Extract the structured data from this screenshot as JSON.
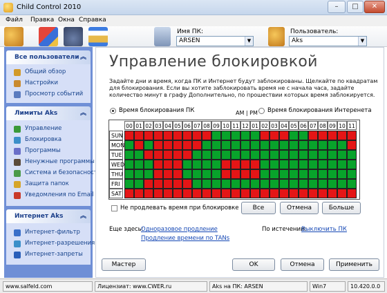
{
  "window": {
    "title": "Child Control 2010",
    "min_glyph": "–",
    "max_glyph": "□",
    "close_glyph": "✕"
  },
  "menu": [
    "Файл",
    "Правка",
    "Окна",
    "Справка"
  ],
  "toolbar": {
    "icons": [
      "users-icon",
      "chart-icon",
      "lock-icon",
      "hourglass-icon"
    ],
    "pc_label": "Имя ПК:",
    "pc_value": "ARSEN",
    "user_label": "Пользователь:",
    "user_value": "Aks",
    "arrow_glyph": "▼"
  },
  "sidebar": {
    "collapse_glyph": "︽",
    "sections": [
      {
        "title": "Все пользователи",
        "items": [
          {
            "label": "Общий обзор",
            "icon": "overview-icon",
            "color": "#d29a2a"
          },
          {
            "label": "Настройки",
            "icon": "settings-icon",
            "color": "#c98a2f"
          },
          {
            "label": "Просмотр событий",
            "icon": "events-icon",
            "color": "#5a7bbf"
          }
        ]
      },
      {
        "title": "Лимиты Aks",
        "items": [
          {
            "label": "Управление",
            "icon": "control-icon",
            "color": "#3a9a3a"
          },
          {
            "label": "Блокировка",
            "icon": "block-icon",
            "color": "#3c8fc9"
          },
          {
            "label": "Программы",
            "icon": "programs-icon",
            "color": "#6a6fc9"
          },
          {
            "label": "Ненужные программы",
            "icon": "unwanted-programs-icon",
            "color": "#5a4a3a"
          },
          {
            "label": "Система и безопасность",
            "icon": "system-icon",
            "color": "#4a9a4a"
          },
          {
            "label": "Защита папок",
            "icon": "folder-protect-icon",
            "color": "#d6a52a"
          },
          {
            "label": "Уведомления по Email",
            "icon": "email-icon",
            "color": "#c93a2a"
          }
        ]
      },
      {
        "title": "Интернет Aks",
        "items": [
          {
            "label": "Интернет-фильтр",
            "icon": "filter-icon",
            "color": "#3a6fc9"
          },
          {
            "label": "Интернет-разрешения",
            "icon": "allow-icon",
            "color": "#3a8fc9"
          },
          {
            "label": "Интернет-запреты",
            "icon": "deny-icon",
            "color": "#2a5fb9"
          }
        ]
      }
    ]
  },
  "main": {
    "heading": "Управление блокировкой",
    "description": "Задайте дни и время, когда ПК и Интернет будут заблокированы. Щелкайте по квадратам для блокирования. Если вы хотите заблокировать время не с начала часа, задайте количество минут в графу  Дополнительно, по прошествии которых время заблокируется.",
    "radio_pc": "Время блокирования ПК",
    "radio_inet": "Время блокирования Интеренета",
    "ampm": "AM | PM",
    "hours": [
      "00",
      "01",
      "02",
      "03",
      "04",
      "05",
      "06",
      "07",
      "08",
      "09",
      "10",
      "11",
      "12",
      "01",
      "02",
      "03",
      "04",
      "05",
      "06",
      "07",
      "08",
      "09",
      "10",
      "11"
    ],
    "days": [
      "SUN",
      "MON",
      "TUE",
      "WED",
      "THU",
      "FRI",
      "SAT"
    ],
    "grid": [
      "RRRRRRRRRGGGGGRRRGGRRRRR",
      "GRGRRRRRGGGGGGGGGGGGGGGR",
      "GGRRRRRGGGGGGGGGGGGGGGGG",
      "GGGRRRGGGGRRRRGGGGGGGGGG",
      "GGGRRRGGGGRRRRGGGGGGGGGG",
      "GGRRRRRGGGGGGGGGGGGGGGGG",
      "RRRRRRRRRRRRRRRRRRRRRRRR"
    ],
    "noextend_label": "Не продлевать время при блокировке",
    "btn_all": "Все",
    "btn_cancel_grid": "Отмена",
    "btn_more": "Больше",
    "more_here": "Еще здесь:",
    "link_once": "Одноразовое продление",
    "link_tans": "Продление времени по TANs",
    "on_expire": "По истечении:",
    "link_shutdown": "Выключить ПК"
  },
  "footer": {
    "master": "Мастер",
    "ok": "OK",
    "cancel": "Отмена",
    "apply": "Применить"
  },
  "statusbar": {
    "site": "www.salfeld.com",
    "license": "Лицензиат: www.CWER.ru",
    "session": "Aks на ПК: ARSEN",
    "os": "Win7",
    "version": "10.420.0.0"
  },
  "colors": {
    "blocked": "#e41516",
    "allowed": "#08a32b",
    "sidebar": "#6f8fd6",
    "link": "#1346b4"
  }
}
